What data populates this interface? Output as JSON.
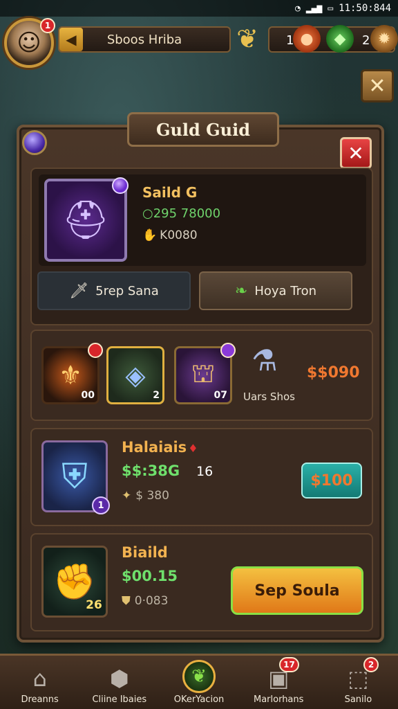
{
  "status_bar": {
    "time": "11:50:844"
  },
  "header": {
    "avatar_badge": "1",
    "player_name": "Sboos Hriba",
    "currency1_value": "1",
    "currency2_value": "2"
  },
  "panel": {
    "title": "Guld Guid",
    "featured": {
      "title": "Saild G",
      "price": "○295 78000",
      "sub_value": "K0080",
      "button_left": "5rep Sana",
      "button_right": "Hoya Tron"
    },
    "strip": {
      "slot1_count": "00",
      "slot2_count": "2",
      "slot3_count": "07",
      "slot4_label": "Uars Shos",
      "price": "$$090"
    },
    "rows": [
      {
        "title": "Halaiais",
        "price": "$$:38G",
        "qty": "16",
        "sub_value": "$ 380",
        "level": "1",
        "buy_label": "$100"
      },
      {
        "title": "Biaild",
        "price": "$00.15",
        "sub_value": "0·083",
        "level": "26",
        "buy_label": "Sep Soula"
      }
    ]
  },
  "bottom_nav": {
    "items": [
      {
        "label": "Dreanns",
        "icon": "house-icon"
      },
      {
        "label": "Cliine Ibaies",
        "icon": "stone-icon"
      },
      {
        "label": "OKerYacion",
        "icon": "leaf-icon"
      },
      {
        "label": "Marlorhans",
        "icon": "crate-icon",
        "badge": "17"
      },
      {
        "label": "Sanilo",
        "icon": "cube-icon",
        "badge": "2"
      }
    ]
  },
  "colors": {
    "panel_bg": "#3a2a20",
    "accent_gold": "#f2b250",
    "price_green": "#6fe06c",
    "price_orange": "#f07830",
    "close_red": "#d8262a"
  }
}
